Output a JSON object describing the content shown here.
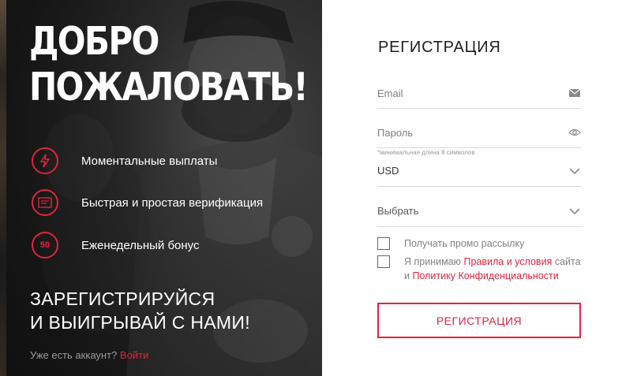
{
  "promo": {
    "headline_line1": "ДОБРО",
    "headline_line2": "ПОЖАЛОВАТЬ!",
    "features": [
      {
        "label": "Моментальные выплаты",
        "icon": "instant-payout-icon"
      },
      {
        "label": "Быстрая и простая верификация",
        "icon": "id-card-icon"
      },
      {
        "label": "Еженедельный бонус",
        "icon": "bonus-50-icon",
        "icon_text": "50"
      }
    ],
    "cta_line1": "ЗАРЕГИСТРИРУЙСЯ",
    "cta_line2": "И ВЫИГРЫВАЙ С НАМИ!",
    "have_account_text": "Уже есть аккаунт?",
    "login_link": "Войти"
  },
  "form": {
    "title": "РЕГИСТРАЦИЯ",
    "email_placeholder": "Email",
    "password_placeholder": "Пароль",
    "password_hint": "*минимальная длина 8 символов",
    "currency_value": "USD",
    "select_placeholder": "Выбрать",
    "promo_checkbox_label": "Получать промо рассылку",
    "terms_prefix": "Я принимаю",
    "terms_link": "Правила и условия",
    "terms_middle": "сайта",
    "terms_and": "и",
    "privacy_link": "Политику Конфиденциальности",
    "submit_label": "РЕГИСТРАЦИЯ"
  },
  "colors": {
    "accent": "#e0243f",
    "panel_dark": "#222222",
    "field_line": "#d9d9d9"
  }
}
